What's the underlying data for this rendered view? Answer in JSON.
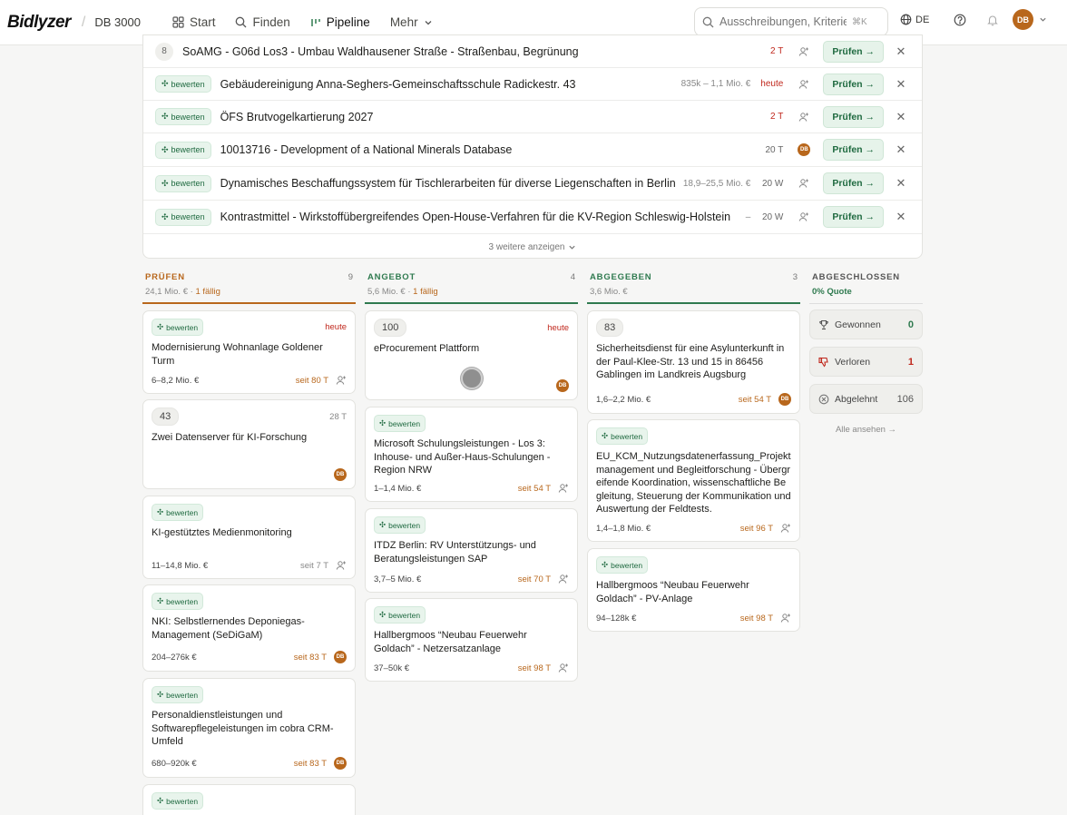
{
  "header": {
    "logo": "Bidlyzer",
    "workspace": "DB 3000",
    "nav": [
      "Start",
      "Finden",
      "Pipeline",
      "Mehr"
    ],
    "search_placeholder": "Ausschreibungen, Kriterien,",
    "search_shortcut": "⌘K",
    "lang": "DE",
    "user_initials": "DB"
  },
  "toplist": {
    "rows": [
      {
        "num": "8",
        "badge": "",
        "title": "SoAMG - G06d Los3 - Umbau Waldhausener Straße - Straßenbau, Begrünung",
        "value": "",
        "due": "2 T",
        "due_red": true,
        "assignee": ""
      },
      {
        "num": "",
        "badge": "bewerten",
        "title": "Gebäudereinigung Anna-Seghers-Gemeinschaftsschule Radickestr. 43",
        "value": "835k – 1,1 Mio. €",
        "due": "heute",
        "due_red": true,
        "assignee": ""
      },
      {
        "num": "",
        "badge": "bewerten",
        "title": "ÖFS Brutvogelkartierung 2027",
        "value": "",
        "due": "2 T",
        "due_red": true,
        "assignee": ""
      },
      {
        "num": "",
        "badge": "bewerten",
        "title": "10013716 - Development of a National Minerals Database",
        "value": "",
        "due": "20 T",
        "due_red": false,
        "assignee": "DB"
      },
      {
        "num": "",
        "badge": "bewerten",
        "title": "Dynamisches Beschaffungssystem für Tischlerarbeiten für diverse Liegenschaften in Berlin",
        "value": "18,9–25,5 Mio. €",
        "due": "20 W",
        "due_red": false,
        "assignee": ""
      },
      {
        "num": "",
        "badge": "bewerten",
        "title": "Kontrastmittel - Wirkstoffübergreifendes Open-House-Verfahren für die KV-Region Schleswig-Holstein",
        "value": "–",
        "due": "20 W",
        "due_red": false,
        "assignee": ""
      }
    ],
    "action_label": "Prüfen →",
    "more_label": "3 weitere anzeigen"
  },
  "columns": [
    {
      "title": "PRÜFEN",
      "count": "9",
      "sum": "24,1 Mio. € ·",
      "flag": "1 fällig",
      "color": "#b8671c"
    },
    {
      "title": "ANGEBOT",
      "count": "4",
      "sum": "5,6 Mio. € ·",
      "flag": "1 fällig",
      "color": "#2f7a4f"
    },
    {
      "title": "ABGEGEBEN",
      "count": "3",
      "sum": "3,6 Mio. €",
      "flag": "",
      "color": "#2f7a4f"
    },
    {
      "title": "ABGESCHLOSSEN",
      "count": "",
      "sum": "0% Quote",
      "flag": "",
      "color": "#2f7a4f"
    }
  ],
  "cards": {
    "pruefen": [
      {
        "badge": "bewerten",
        "due": "heute",
        "title": "Modernisierung Wohnanlage Goldener Turm",
        "value": "6–8,2 Mio. €",
        "since": "seit 80 T",
        "assignee": ""
      },
      {
        "num": "43",
        "due": "28 T",
        "title": "Zwei Datenserver für KI-Forschung",
        "value": "",
        "since": "",
        "assignee": "DB"
      },
      {
        "badge": "bewerten",
        "title": "KI-gestütztes Medienmonitoring",
        "value": "11–14,8 Mio. €",
        "since": "seit 7 T",
        "assignee": ""
      },
      {
        "badge": "bewerten",
        "title": "NKI: Selbstlernendes Deponiegas-Management (SeDiGaM)",
        "value": "204–276k €",
        "since": "seit 83 T",
        "assignee": "DB"
      },
      {
        "badge": "bewerten",
        "title": "Personaldienstleistungen und Softwarepflegeleistungen im cobra CRM-Umfeld",
        "value": "680–920k €",
        "since": "seit 83 T",
        "assignee": "DB"
      },
      {
        "badge": "bewerten",
        "title": "",
        "value": "",
        "since": "",
        "assignee": ""
      }
    ],
    "angebot": [
      {
        "num": "100",
        "due": "heute",
        "title": "eProcurement Plattform",
        "value": "",
        "since": "",
        "assignee": "DB"
      },
      {
        "badge": "bewerten",
        "title": "Microsoft Schulungsleistungen - Los 3: Inhouse- und Außer-Haus-Schulungen - Region NRW",
        "value": "1–1,4 Mio. €",
        "since": "seit 54 T",
        "assignee": ""
      },
      {
        "badge": "bewerten",
        "title": "ITDZ Berlin: RV Unterstützungs- und Beratungsleistungen SAP",
        "value": "3,7–5 Mio. €",
        "since": "seit 70 T",
        "assignee": ""
      },
      {
        "badge": "bewerten",
        "title": "Hallbergmoos “Neubau Feuerwehr Goldach” - Netzersatzanlage",
        "value": "37–50k €",
        "since": "seit 98 T",
        "assignee": ""
      }
    ],
    "abgegeben": [
      {
        "num": "83",
        "title": "Sicherheitsdienst für eine Asylunterkunft in der Paul-Klee-Str. 13 und 15 in 86456 Gablingen im Landkreis Augsburg",
        "value": "1,6–2,2 Mio. €",
        "since": "seit 54 T",
        "assignee": "DB"
      },
      {
        "badge": "bewerten",
        "title": "EU_KCM_Nutzungsdatenerfassung_Projektmanagement und Begleitforschung - Übergreifende Koordination, wissenschaftliche Begleitung, Steuerung der Kommunikation und Auswertung der Feldtests.",
        "value": "1,4–1,8 Mio. €",
        "since": "seit 96 T",
        "assignee": ""
      },
      {
        "badge": "bewerten",
        "title": "Hallbergmoos “Neubau Feuerwehr Goldach” - PV-Anlage",
        "value": "94–128k €",
        "since": "seit 98 T",
        "assignee": ""
      }
    ]
  },
  "closed": {
    "won_label": "Gewonnen",
    "won": "0",
    "lost_label": "Verloren",
    "lost": "1",
    "rejected_label": "Abgelehnt",
    "rejected": "106",
    "all_label": "Alle ansehen →"
  }
}
